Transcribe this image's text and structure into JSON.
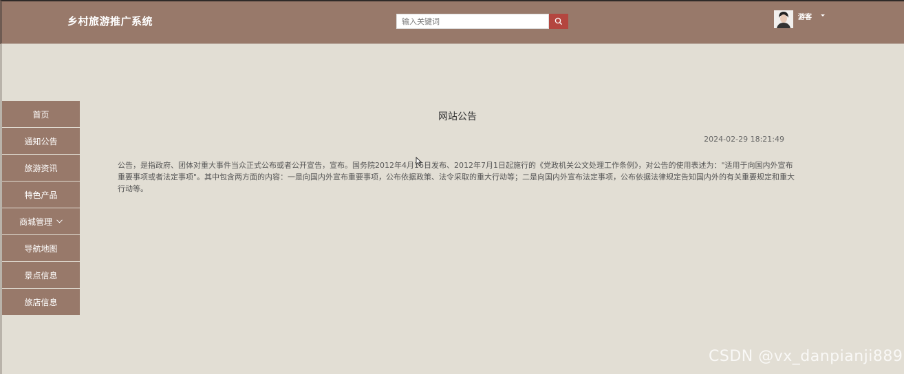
{
  "header": {
    "app_title": "乡村旅游推广系统",
    "search_placeholder": "输入关键词",
    "user_name": "游客",
    "icons": {
      "search": "search-icon",
      "caret": "caret-down-icon"
    },
    "colors": {
      "bar": "#98796a",
      "search_button": "#b4463f"
    }
  },
  "sidebar": {
    "items": [
      {
        "label": "首页"
      },
      {
        "label": "通知公告"
      },
      {
        "label": "旅游资讯"
      },
      {
        "label": "特色产品"
      },
      {
        "label": "商城管理",
        "has_dropdown": true
      },
      {
        "label": "导航地图"
      },
      {
        "label": "景点信息"
      },
      {
        "label": "旅店信息"
      }
    ]
  },
  "notice": {
    "title": "网站公告",
    "time": "2024-02-29 18:21:49",
    "content": "公告，是指政府、团体对重大事件当众正式公布或者公开宣告，宣布。国务院2012年4月16日发布、2012年7月1日起施行的《党政机关公文处理工作条例》，对公告的使用表述为：\"适用于向国内外宣布重要事项或者法定事项\"。其中包含两方面的内容：一是向国内外宣布重要事项，公布依据政策、法令采取的重大行动等；二是向国内外宣布法定事项，公布依据法律规定告知国内外的有关重要规定和重大行动等。"
  },
  "watermark": "CSDN @vx_danpianji889"
}
